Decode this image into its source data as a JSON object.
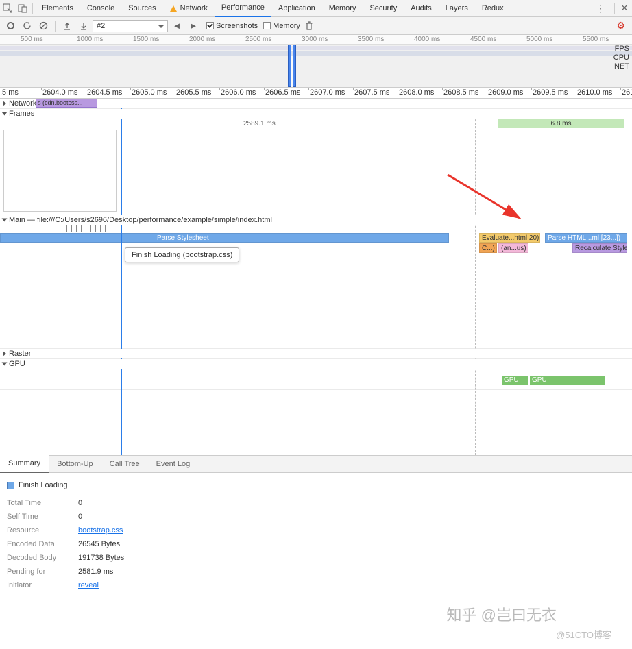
{
  "tabs": {
    "elements": "Elements",
    "console": "Console",
    "sources": "Sources",
    "network": "Network",
    "performance": "Performance",
    "application": "Application",
    "memory": "Memory",
    "security": "Security",
    "audits": "Audits",
    "layers": "Layers",
    "redux": "Redux"
  },
  "toolbar": {
    "profile_select": "#2",
    "screenshots_label": "Screenshots",
    "memory_label": "Memory"
  },
  "overview": {
    "ticks": [
      "500 ms",
      "1000 ms",
      "1500 ms",
      "2000 ms",
      "2500 ms",
      "3000 ms",
      "3500 ms",
      "4000 ms",
      "4500 ms",
      "5000 ms",
      "5500 ms"
    ],
    "lanes": [
      "FPS",
      "CPU",
      "NET"
    ]
  },
  "ruler": {
    "ticks": [
      ".5 ms",
      "2604.0 ms",
      "2604.5 ms",
      "2605.0 ms",
      "2605.5 ms",
      "2606.0 ms",
      "2606.5 ms",
      "2607.0 ms",
      "2607.5 ms",
      "2608.0 ms",
      "2608.5 ms",
      "2609.0 ms",
      "2609.5 ms",
      "2610.0 ms",
      "261"
    ]
  },
  "network": {
    "header": "Network",
    "bar": "s (cdn.bootcss..."
  },
  "frames": {
    "header": "Frames",
    "t1": "2589.1 ms",
    "t2": "6.8 ms"
  },
  "main": {
    "header": "Main — file:///C:/Users/s2696/Desktop/performance/example/simple/index.html",
    "parse_ss": "Parse Stylesheet",
    "tooltip": "Finish Loading (bootstrap.css)",
    "eval": "Evaluate...html:20)",
    "c": "C...)",
    "anus": "(an...us)",
    "parse_html": "Parse HTML...ml [23...])",
    "recalc": "Recalculate Style"
  },
  "raster": {
    "header": "Raster"
  },
  "gpu": {
    "header": "GPU",
    "bar": "GPU"
  },
  "btabs": {
    "summary": "Summary",
    "bottomup": "Bottom-Up",
    "calltree": "Call Tree",
    "eventlog": "Event Log"
  },
  "summary": {
    "title": "Finish Loading",
    "rows": [
      {
        "k": "Total Time",
        "v": "0"
      },
      {
        "k": "Self Time",
        "v": "0"
      },
      {
        "k": "Resource",
        "v": "bootstrap.css",
        "link": true
      },
      {
        "k": "Encoded Data",
        "v": "26545 Bytes"
      },
      {
        "k": "Decoded Body",
        "v": "191738 Bytes"
      },
      {
        "k": "Pending for",
        "v": "2581.9 ms"
      },
      {
        "k": "Initiator",
        "v": "reveal",
        "link": true
      }
    ]
  },
  "watermark1": "知乎 @岂曰无衣",
  "watermark2": "@51CTO博客"
}
